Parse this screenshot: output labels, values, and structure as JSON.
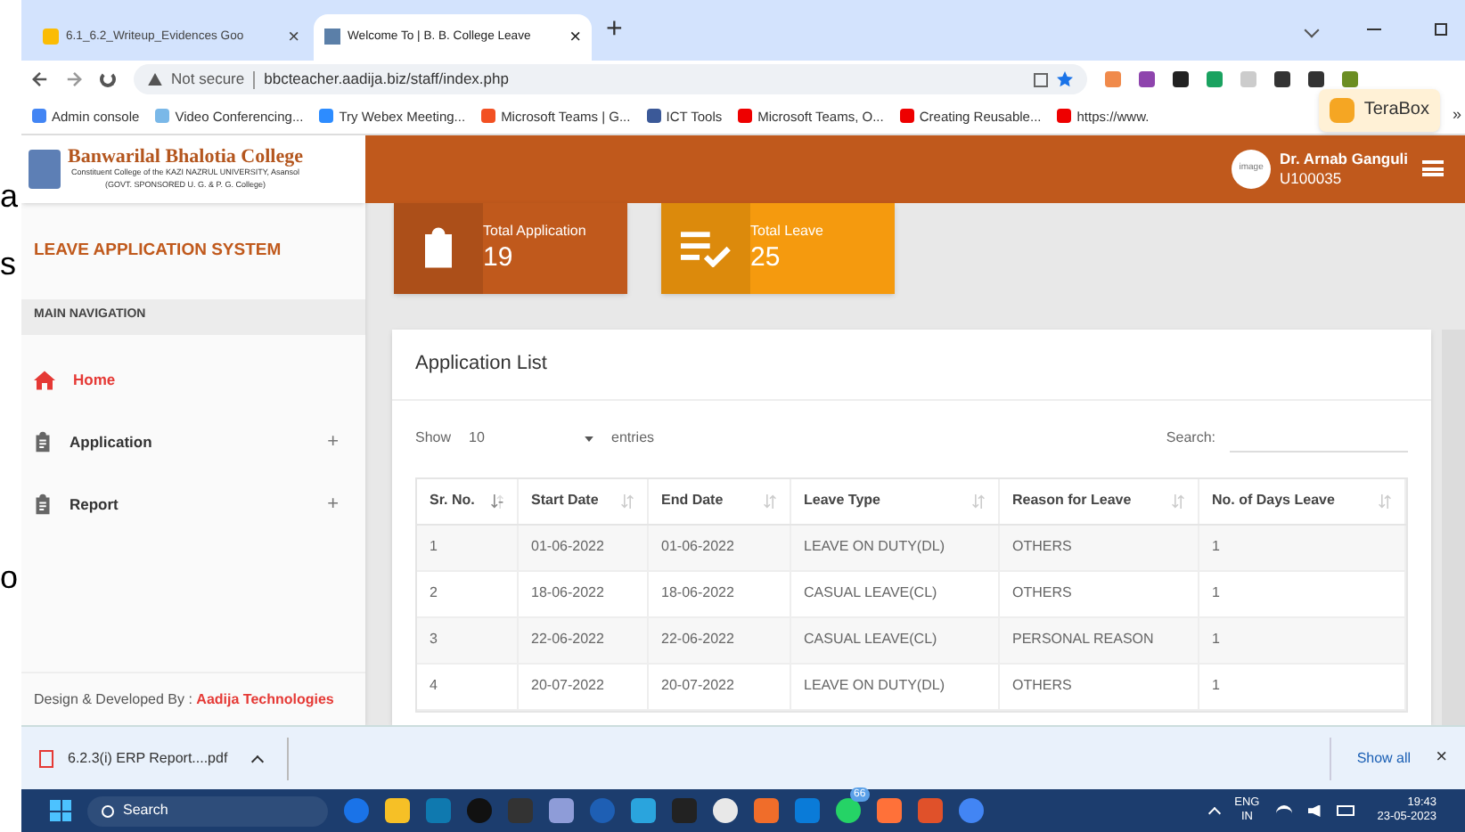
{
  "background_letters": [
    "a",
    "s",
    "o"
  ],
  "browser": {
    "tabs": [
      {
        "title": "6.1_6.2_Writeup_Evidences  Goo",
        "close": "×",
        "selected": false
      },
      {
        "title": "Welcome To | B. B. College Leave",
        "close": "×",
        "selected": true
      }
    ],
    "new_tab": "+",
    "address": {
      "security": "Not secure",
      "url": "bbcteacher.aadija.biz/staff/index.php"
    },
    "bookmarks": [
      "Admin console",
      "Video Conferencing...",
      "Try Webex Meeting...",
      "Microsoft Teams | G...",
      "ICT Tools",
      "Microsoft Teams, O...",
      "Creating Reusable...",
      "https://www."
    ],
    "terabox": "TeraBox",
    "more": "»"
  },
  "header": {
    "college": "Banwarilal Bhalotia College",
    "subtitle": "Constituent College of the KAZI NAZRUL UNIVERSITY, Asansol",
    "subtitle2": "(GOVT. SPONSORED U. G. & P. G. College)",
    "user_name": "Dr. Arnab Ganguli",
    "user_id": "U100035",
    "avatar_text": "image"
  },
  "sidebar": {
    "system_title": "LEAVE APPLICATION SYSTEM",
    "section": "MAIN NAVIGATION",
    "items": [
      {
        "kind": "home",
        "label": "Home",
        "selected": true
      },
      {
        "kind": "clipboard",
        "label": "Application",
        "expander": "+",
        "selected": false
      },
      {
        "kind": "clipboard",
        "label": "Report",
        "expander": "+",
        "selected": false
      }
    ],
    "footer_prefix": "Design & Developed By : ",
    "footer_link": "Aadija Technologies"
  },
  "stats": [
    {
      "kind": "clipboard",
      "label": "Total Application",
      "value": "19",
      "color": "#c0591c"
    },
    {
      "kind": "checklist",
      "label": "Total Leave",
      "value": "25",
      "color": "#f59a0e"
    }
  ],
  "application_list": {
    "title": "Application List",
    "show_label": "Show",
    "page_size": "10",
    "entries_label": "entries",
    "search_label": "Search:",
    "columns": [
      {
        "label": "Sr. No.",
        "sorted": true
      },
      {
        "label": "Start Date",
        "sorted": false
      },
      {
        "label": "End Date",
        "sorted": false
      },
      {
        "label": "Leave Type",
        "sorted": false
      },
      {
        "label": "Reason for Leave",
        "sorted": false
      },
      {
        "label": "No. of Days Leave",
        "sorted": false
      }
    ],
    "rows": [
      [
        "1",
        "01-06-2022",
        "01-06-2022",
        "LEAVE ON DUTY(DL)",
        "OTHERS",
        "1"
      ],
      [
        "2",
        "18-06-2022",
        "18-06-2022",
        "CASUAL LEAVE(CL)",
        "OTHERS",
        "1"
      ],
      [
        "3",
        "22-06-2022",
        "22-06-2022",
        "CASUAL LEAVE(CL)",
        "PERSONAL REASON",
        "1"
      ],
      [
        "4",
        "20-07-2022",
        "20-07-2022",
        "LEAVE ON DUTY(DL)",
        "OTHERS",
        "1"
      ]
    ]
  },
  "download_bar": {
    "file": "6.2.3(i) ERP Report....pdf",
    "show_all": "Show all",
    "close": "×"
  },
  "taskbar": {
    "search": "Search",
    "badge": "66",
    "language": "ENG",
    "region": "IN",
    "time": "19:43",
    "date": "23-05-2023"
  }
}
